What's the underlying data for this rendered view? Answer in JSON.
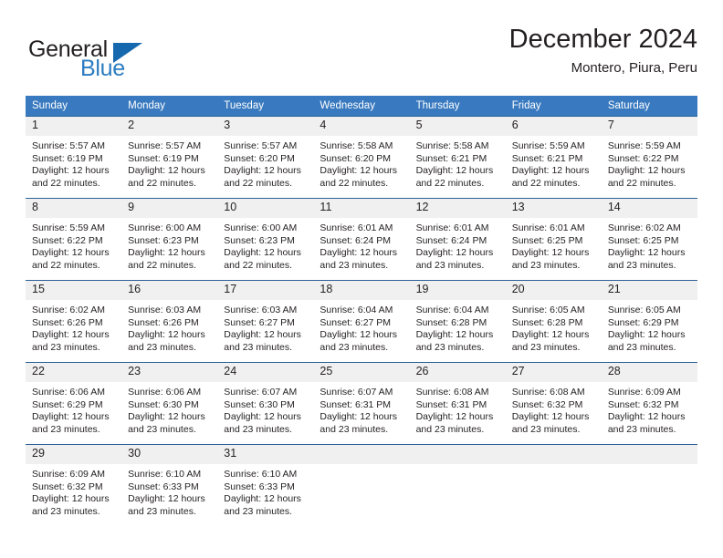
{
  "brand": {
    "name_part1": "General",
    "name_part2": "Blue",
    "triangle_icon": "triangle-icon"
  },
  "header": {
    "title": "December 2024",
    "subtitle": "Montero, Piura, Peru"
  },
  "colors": {
    "header_blue": "#3879bf",
    "grid_line_blue": "#2a6099",
    "daynum_band": "#f0f0f0",
    "brand_blue": "#2b7cc0",
    "text": "#231f20"
  },
  "weekday_headers": [
    "Sunday",
    "Monday",
    "Tuesday",
    "Wednesday",
    "Thursday",
    "Friday",
    "Saturday"
  ],
  "weeks": [
    [
      {
        "day": "1",
        "sunrise": "Sunrise: 5:57 AM",
        "sunset": "Sunset: 6:19 PM",
        "daylight_line1": "Daylight: 12 hours",
        "daylight_line2": "and 22 minutes."
      },
      {
        "day": "2",
        "sunrise": "Sunrise: 5:57 AM",
        "sunset": "Sunset: 6:19 PM",
        "daylight_line1": "Daylight: 12 hours",
        "daylight_line2": "and 22 minutes."
      },
      {
        "day": "3",
        "sunrise": "Sunrise: 5:57 AM",
        "sunset": "Sunset: 6:20 PM",
        "daylight_line1": "Daylight: 12 hours",
        "daylight_line2": "and 22 minutes."
      },
      {
        "day": "4",
        "sunrise": "Sunrise: 5:58 AM",
        "sunset": "Sunset: 6:20 PM",
        "daylight_line1": "Daylight: 12 hours",
        "daylight_line2": "and 22 minutes."
      },
      {
        "day": "5",
        "sunrise": "Sunrise: 5:58 AM",
        "sunset": "Sunset: 6:21 PM",
        "daylight_line1": "Daylight: 12 hours",
        "daylight_line2": "and 22 minutes."
      },
      {
        "day": "6",
        "sunrise": "Sunrise: 5:59 AM",
        "sunset": "Sunset: 6:21 PM",
        "daylight_line1": "Daylight: 12 hours",
        "daylight_line2": "and 22 minutes."
      },
      {
        "day": "7",
        "sunrise": "Sunrise: 5:59 AM",
        "sunset": "Sunset: 6:22 PM",
        "daylight_line1": "Daylight: 12 hours",
        "daylight_line2": "and 22 minutes."
      }
    ],
    [
      {
        "day": "8",
        "sunrise": "Sunrise: 5:59 AM",
        "sunset": "Sunset: 6:22 PM",
        "daylight_line1": "Daylight: 12 hours",
        "daylight_line2": "and 22 minutes."
      },
      {
        "day": "9",
        "sunrise": "Sunrise: 6:00 AM",
        "sunset": "Sunset: 6:23 PM",
        "daylight_line1": "Daylight: 12 hours",
        "daylight_line2": "and 22 minutes."
      },
      {
        "day": "10",
        "sunrise": "Sunrise: 6:00 AM",
        "sunset": "Sunset: 6:23 PM",
        "daylight_line1": "Daylight: 12 hours",
        "daylight_line2": "and 22 minutes."
      },
      {
        "day": "11",
        "sunrise": "Sunrise: 6:01 AM",
        "sunset": "Sunset: 6:24 PM",
        "daylight_line1": "Daylight: 12 hours",
        "daylight_line2": "and 23 minutes."
      },
      {
        "day": "12",
        "sunrise": "Sunrise: 6:01 AM",
        "sunset": "Sunset: 6:24 PM",
        "daylight_line1": "Daylight: 12 hours",
        "daylight_line2": "and 23 minutes."
      },
      {
        "day": "13",
        "sunrise": "Sunrise: 6:01 AM",
        "sunset": "Sunset: 6:25 PM",
        "daylight_line1": "Daylight: 12 hours",
        "daylight_line2": "and 23 minutes."
      },
      {
        "day": "14",
        "sunrise": "Sunrise: 6:02 AM",
        "sunset": "Sunset: 6:25 PM",
        "daylight_line1": "Daylight: 12 hours",
        "daylight_line2": "and 23 minutes."
      }
    ],
    [
      {
        "day": "15",
        "sunrise": "Sunrise: 6:02 AM",
        "sunset": "Sunset: 6:26 PM",
        "daylight_line1": "Daylight: 12 hours",
        "daylight_line2": "and 23 minutes."
      },
      {
        "day": "16",
        "sunrise": "Sunrise: 6:03 AM",
        "sunset": "Sunset: 6:26 PM",
        "daylight_line1": "Daylight: 12 hours",
        "daylight_line2": "and 23 minutes."
      },
      {
        "day": "17",
        "sunrise": "Sunrise: 6:03 AM",
        "sunset": "Sunset: 6:27 PM",
        "daylight_line1": "Daylight: 12 hours",
        "daylight_line2": "and 23 minutes."
      },
      {
        "day": "18",
        "sunrise": "Sunrise: 6:04 AM",
        "sunset": "Sunset: 6:27 PM",
        "daylight_line1": "Daylight: 12 hours",
        "daylight_line2": "and 23 minutes."
      },
      {
        "day": "19",
        "sunrise": "Sunrise: 6:04 AM",
        "sunset": "Sunset: 6:28 PM",
        "daylight_line1": "Daylight: 12 hours",
        "daylight_line2": "and 23 minutes."
      },
      {
        "day": "20",
        "sunrise": "Sunrise: 6:05 AM",
        "sunset": "Sunset: 6:28 PM",
        "daylight_line1": "Daylight: 12 hours",
        "daylight_line2": "and 23 minutes."
      },
      {
        "day": "21",
        "sunrise": "Sunrise: 6:05 AM",
        "sunset": "Sunset: 6:29 PM",
        "daylight_line1": "Daylight: 12 hours",
        "daylight_line2": "and 23 minutes."
      }
    ],
    [
      {
        "day": "22",
        "sunrise": "Sunrise: 6:06 AM",
        "sunset": "Sunset: 6:29 PM",
        "daylight_line1": "Daylight: 12 hours",
        "daylight_line2": "and 23 minutes."
      },
      {
        "day": "23",
        "sunrise": "Sunrise: 6:06 AM",
        "sunset": "Sunset: 6:30 PM",
        "daylight_line1": "Daylight: 12 hours",
        "daylight_line2": "and 23 minutes."
      },
      {
        "day": "24",
        "sunrise": "Sunrise: 6:07 AM",
        "sunset": "Sunset: 6:30 PM",
        "daylight_line1": "Daylight: 12 hours",
        "daylight_line2": "and 23 minutes."
      },
      {
        "day": "25",
        "sunrise": "Sunrise: 6:07 AM",
        "sunset": "Sunset: 6:31 PM",
        "daylight_line1": "Daylight: 12 hours",
        "daylight_line2": "and 23 minutes."
      },
      {
        "day": "26",
        "sunrise": "Sunrise: 6:08 AM",
        "sunset": "Sunset: 6:31 PM",
        "daylight_line1": "Daylight: 12 hours",
        "daylight_line2": "and 23 minutes."
      },
      {
        "day": "27",
        "sunrise": "Sunrise: 6:08 AM",
        "sunset": "Sunset: 6:32 PM",
        "daylight_line1": "Daylight: 12 hours",
        "daylight_line2": "and 23 minutes."
      },
      {
        "day": "28",
        "sunrise": "Sunrise: 6:09 AM",
        "sunset": "Sunset: 6:32 PM",
        "daylight_line1": "Daylight: 12 hours",
        "daylight_line2": "and 23 minutes."
      }
    ],
    [
      {
        "day": "29",
        "sunrise": "Sunrise: 6:09 AM",
        "sunset": "Sunset: 6:32 PM",
        "daylight_line1": "Daylight: 12 hours",
        "daylight_line2": "and 23 minutes."
      },
      {
        "day": "30",
        "sunrise": "Sunrise: 6:10 AM",
        "sunset": "Sunset: 6:33 PM",
        "daylight_line1": "Daylight: 12 hours",
        "daylight_line2": "and 23 minutes."
      },
      {
        "day": "31",
        "sunrise": "Sunrise: 6:10 AM",
        "sunset": "Sunset: 6:33 PM",
        "daylight_line1": "Daylight: 12 hours",
        "daylight_line2": "and 23 minutes."
      },
      {
        "day": "",
        "sunrise": "",
        "sunset": "",
        "daylight_line1": "",
        "daylight_line2": ""
      },
      {
        "day": "",
        "sunrise": "",
        "sunset": "",
        "daylight_line1": "",
        "daylight_line2": ""
      },
      {
        "day": "",
        "sunrise": "",
        "sunset": "",
        "daylight_line1": "",
        "daylight_line2": ""
      },
      {
        "day": "",
        "sunrise": "",
        "sunset": "",
        "daylight_line1": "",
        "daylight_line2": ""
      }
    ]
  ]
}
